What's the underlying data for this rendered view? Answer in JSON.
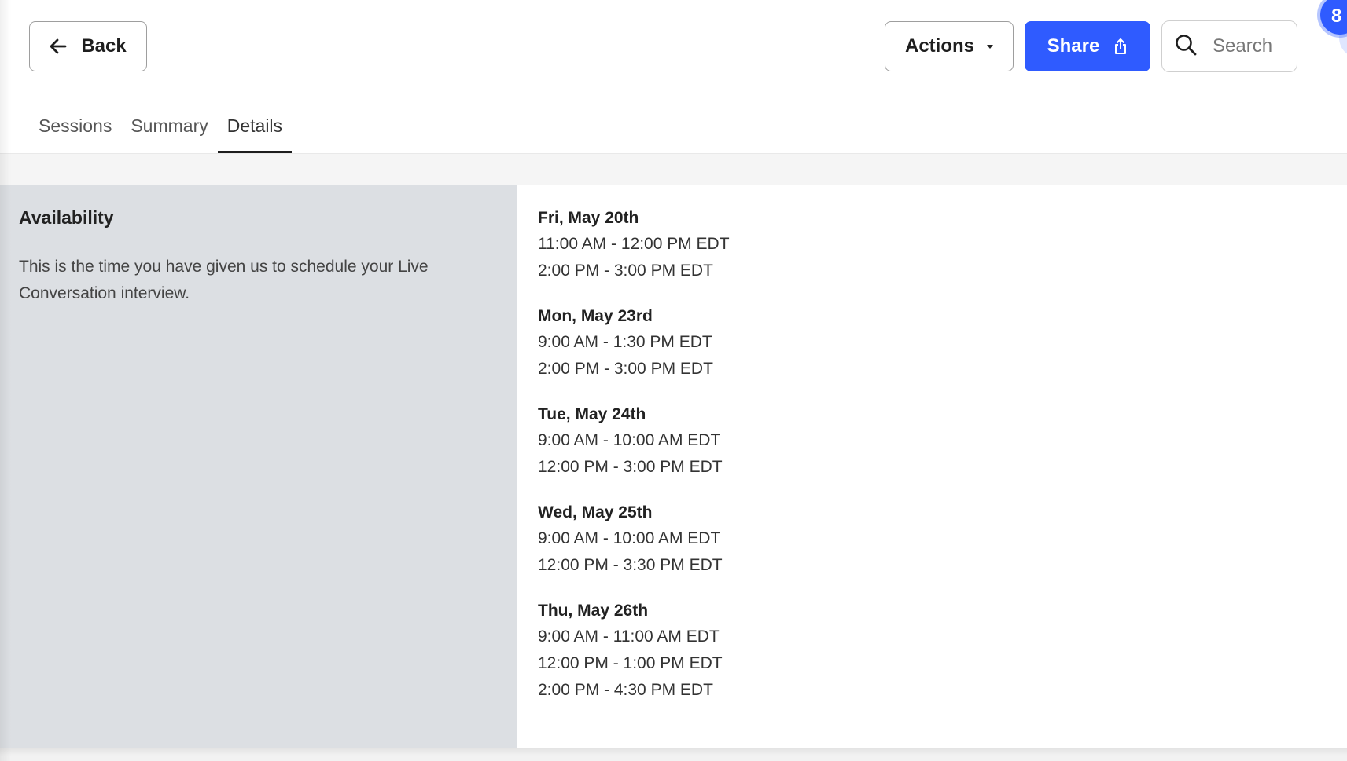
{
  "header": {
    "back_label": "Back",
    "actions_label": "Actions",
    "share_label": "Share",
    "search_placeholder": "Search",
    "notification_count": "8",
    "brand_color": "#2f5bff"
  },
  "tabs": [
    {
      "label": "Sessions",
      "active": false
    },
    {
      "label": "Summary",
      "active": false
    },
    {
      "label": "Details",
      "active": true
    }
  ],
  "availability": {
    "title": "Availability",
    "description": "This is the time you have given us to schedule your Live Conversation interview.",
    "days": [
      {
        "date": "Fri, May 20th",
        "slots": [
          "11:00 AM - 12:00 PM EDT",
          "2:00 PM - 3:00 PM EDT"
        ]
      },
      {
        "date": "Mon, May 23rd",
        "slots": [
          "9:00 AM - 1:30 PM EDT",
          "2:00 PM - 3:00 PM EDT"
        ]
      },
      {
        "date": "Tue, May 24th",
        "slots": [
          "9:00 AM - 10:00 AM EDT",
          "12:00 PM - 3:00 PM EDT"
        ]
      },
      {
        "date": "Wed, May 25th",
        "slots": [
          "9:00 AM - 10:00 AM EDT",
          "12:00 PM - 3:30 PM EDT"
        ]
      },
      {
        "date": "Thu, May 26th",
        "slots": [
          "9:00 AM - 11:00 AM EDT",
          "12:00 PM - 1:00 PM EDT",
          "2:00 PM - 4:30 PM EDT"
        ]
      }
    ]
  }
}
